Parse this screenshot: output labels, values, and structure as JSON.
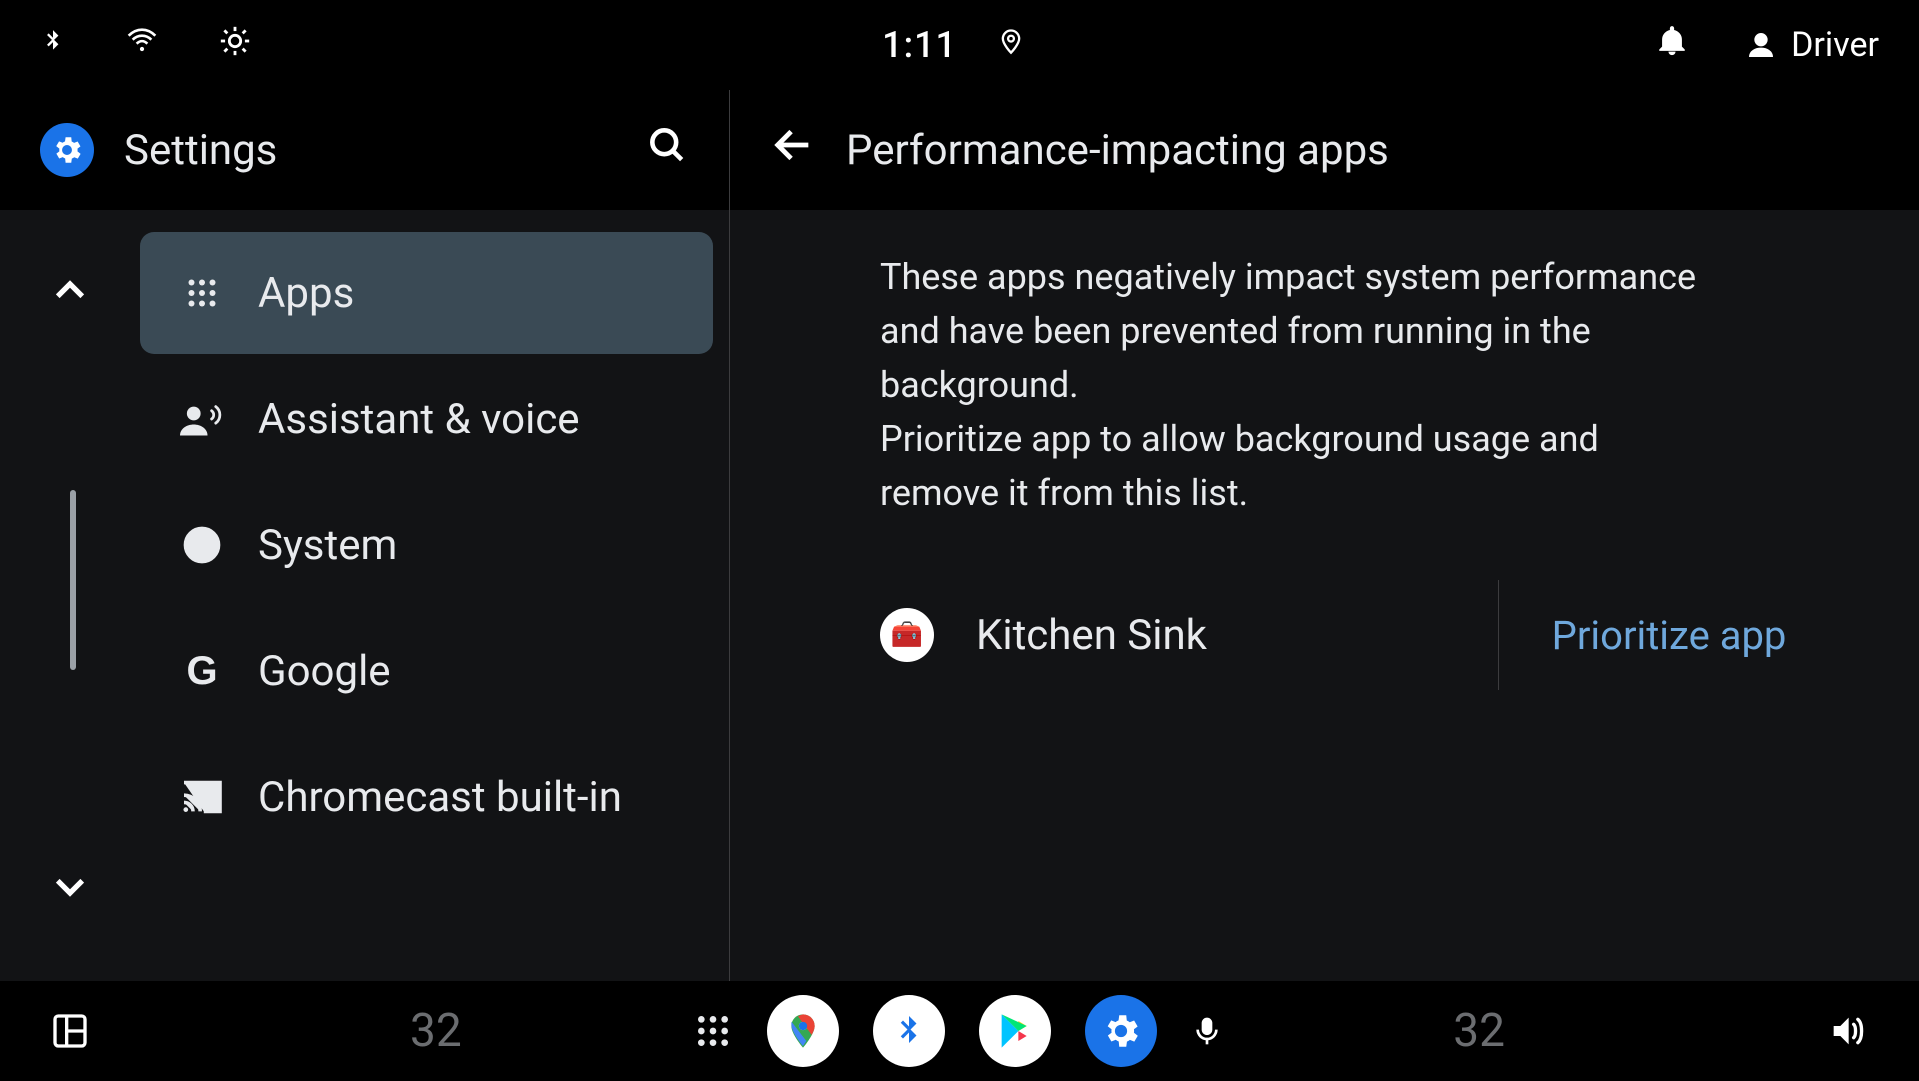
{
  "status": {
    "time": "1:11",
    "user_label": "Driver"
  },
  "left": {
    "title": "Settings",
    "items": [
      {
        "label": "Apps"
      },
      {
        "label": "Assistant & voice"
      },
      {
        "label": "System"
      },
      {
        "label": "Google"
      },
      {
        "label": "Chromecast built-in"
      }
    ]
  },
  "right": {
    "title": "Performance-impacting apps",
    "description": "These apps negatively impact system performance and have been prevented from running in the background.\nPrioritize app to allow background usage and remove it from this list.",
    "apps": [
      {
        "name": "Kitchen Sink",
        "action_label": "Prioritize app"
      }
    ]
  },
  "bottom": {
    "temp_left": "32",
    "temp_right": "32"
  },
  "colors": {
    "accent": "#1a73e8",
    "link": "#6fa8dc"
  }
}
